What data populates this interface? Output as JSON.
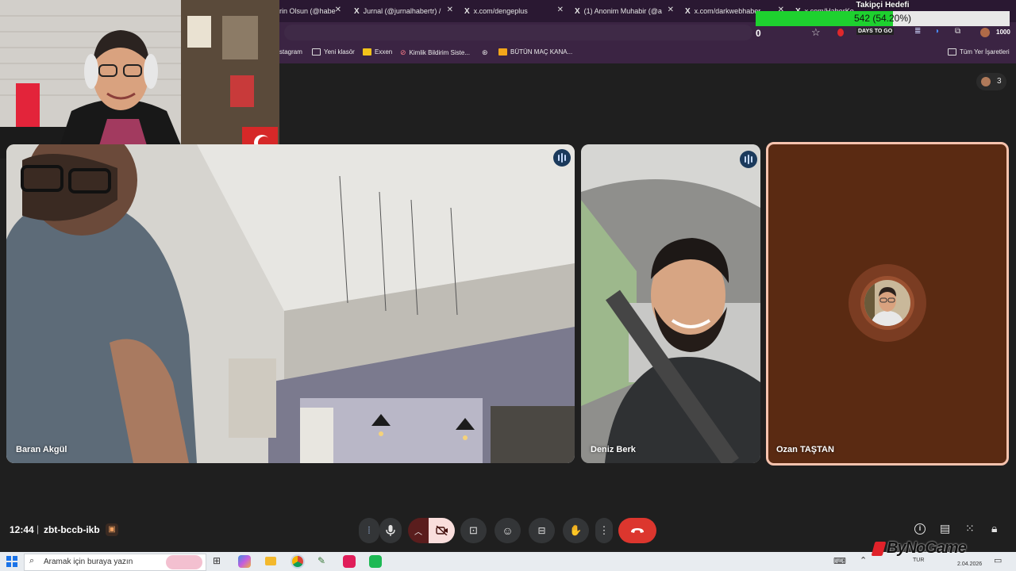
{
  "browser": {
    "tabs": [
      {
        "label": "rin Olsun (@habe",
        "x_icon": false
      },
      {
        "label": "Jurnal (@jurnalhabertr) /",
        "x_icon": true
      },
      {
        "label": "x.com/dengeplus",
        "x_icon": true
      },
      {
        "label": "(1) Anonim Muhabir (@a",
        "x_icon": true
      },
      {
        "label": "x.com/darkwebhaber",
        "x_icon": true
      },
      {
        "label": "x.com/HaberKo",
        "x_icon": true
      }
    ],
    "bookmarks": [
      {
        "label": "stagram"
      },
      {
        "label": "Yeni klasör"
      },
      {
        "label": "Exxen"
      },
      {
        "label": "Kimlik Bildirim Siste..."
      },
      {
        "label": ""
      },
      {
        "label": "BÜTÜN MAÇ KANA..."
      }
    ],
    "all_bookmarks": "Tüm Yer İşaretleri",
    "extension_badge": "DAYS TO GO",
    "counter": "1000"
  },
  "overlay": {
    "title": "Takipçi Hedefi",
    "progress_text": "542 (54.20%)",
    "progress_fraction": 0.542,
    "start_value": "0",
    "fill_color": "#1ed12f"
  },
  "meet": {
    "participant_count": "3",
    "participants": [
      {
        "name": "Baran Akgül",
        "speaking": false
      },
      {
        "name": "Deniz Berk",
        "speaking": true
      },
      {
        "name": "Ozan TAŞTAN",
        "speaking": false
      }
    ],
    "time": "12:44",
    "separator": "|",
    "meeting_code": "zbt-bccb-ikb",
    "accent_color": "#a8c7fa",
    "end_call_color": "#dc362e"
  },
  "taskbar": {
    "search_placeholder": "Aramak için buraya yazın",
    "language": "TUR",
    "date": "2.04.2026",
    "watermark": "ByNoGame"
  }
}
